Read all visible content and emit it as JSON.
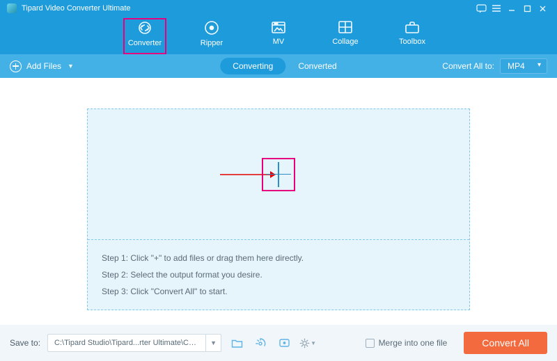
{
  "title": "Tipard Video Converter Ultimate",
  "nav": {
    "converter": "Converter",
    "ripper": "Ripper",
    "mv": "MV",
    "collage": "Collage",
    "toolbox": "Toolbox"
  },
  "subbar": {
    "add_files": "Add Files",
    "converting": "Converting",
    "converted": "Converted",
    "convert_all_to": "Convert All to:",
    "selected_format": "MP4"
  },
  "dropzone": {
    "step1": "Step 1: Click \"+\" to add files or drag them here directly.",
    "step2": "Step 2: Select the output format you desire.",
    "step3": "Step 3: Click \"Convert All\" to start."
  },
  "footer": {
    "save_to_label": "Save to:",
    "save_to_path": "C:\\Tipard Studio\\Tipard...rter Ultimate\\Converted",
    "merge_label": "Merge into one file",
    "convert_all": "Convert All"
  }
}
